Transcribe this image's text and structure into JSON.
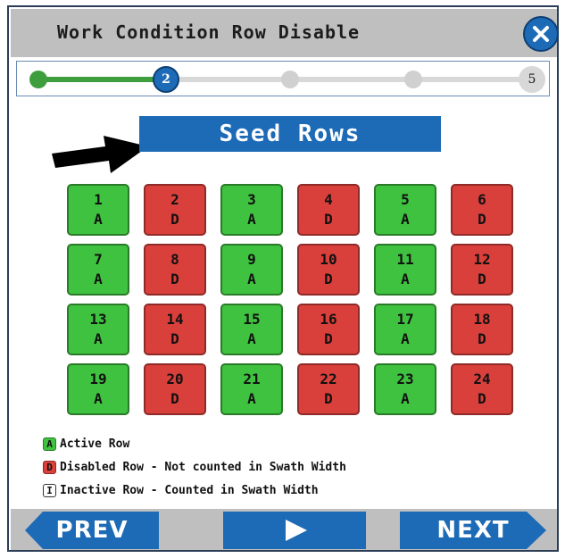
{
  "window": {
    "title": "Work Condition Row Disable"
  },
  "progress": {
    "current_step": "2",
    "total_steps": "5",
    "fraction": 0.25
  },
  "banner": {
    "label": "Seed Rows"
  },
  "rows": [
    {
      "number": "1",
      "status": "A"
    },
    {
      "number": "2",
      "status": "D"
    },
    {
      "number": "3",
      "status": "A"
    },
    {
      "number": "4",
      "status": "D"
    },
    {
      "number": "5",
      "status": "A"
    },
    {
      "number": "6",
      "status": "D"
    },
    {
      "number": "7",
      "status": "A"
    },
    {
      "number": "8",
      "status": "D"
    },
    {
      "number": "9",
      "status": "A"
    },
    {
      "number": "10",
      "status": "D"
    },
    {
      "number": "11",
      "status": "A"
    },
    {
      "number": "12",
      "status": "D"
    },
    {
      "number": "13",
      "status": "A"
    },
    {
      "number": "14",
      "status": "D"
    },
    {
      "number": "15",
      "status": "A"
    },
    {
      "number": "16",
      "status": "D"
    },
    {
      "number": "17",
      "status": "A"
    },
    {
      "number": "18",
      "status": "D"
    },
    {
      "number": "19",
      "status": "A"
    },
    {
      "number": "20",
      "status": "D"
    },
    {
      "number": "21",
      "status": "A"
    },
    {
      "number": "22",
      "status": "D"
    },
    {
      "number": "23",
      "status": "A"
    },
    {
      "number": "24",
      "status": "D"
    }
  ],
  "legend": [
    {
      "key": "A",
      "label": "Active Row"
    },
    {
      "key": "D",
      "label": "Disabled Row - Not counted in Swath Width"
    },
    {
      "key": "I",
      "label": "Inactive Row - Counted in Swath Width"
    }
  ],
  "nav": {
    "prev_label": "PREV",
    "next_label": "NEXT",
    "play_icon": "play-icon"
  },
  "colors": {
    "active": "#3fc23f",
    "disabled": "#d9403b",
    "accent": "#1d6bb6",
    "progress": "#3e9e3e"
  }
}
